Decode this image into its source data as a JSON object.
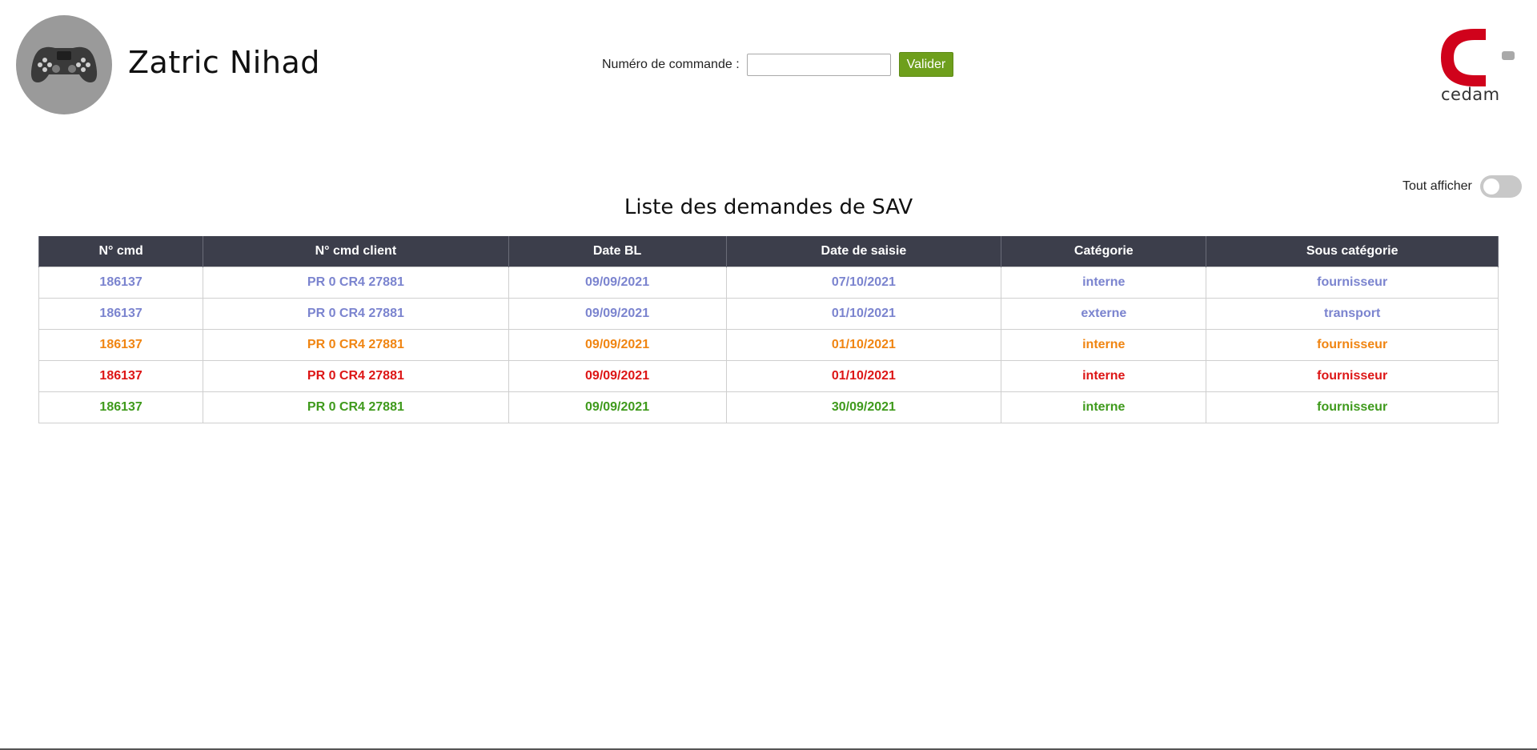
{
  "header": {
    "user_name": "Zatric Nihad",
    "avatar_icon": "gamepad-icon",
    "search": {
      "label": "Numéro de commande :",
      "value": "",
      "placeholder": "",
      "button_label": "Valider"
    },
    "logo": {
      "text": "cedam",
      "color": "#d0021b"
    }
  },
  "toggle": {
    "label": "Tout afficher",
    "state": "off"
  },
  "list": {
    "title": "Liste des demandes de SAV",
    "columns": [
      "N° cmd",
      "N° cmd client",
      "Date BL",
      "Date de saisie",
      "Catégorie",
      "Sous catégorie"
    ],
    "rows": [
      {
        "color": "#7b84cf",
        "cells": [
          "186137",
          "PR 0 CR4 27881",
          "09/09/2021",
          "07/10/2021",
          "interne",
          "fournisseur"
        ]
      },
      {
        "color": "#7b84cf",
        "cells": [
          "186137",
          "PR 0 CR4 27881",
          "09/09/2021",
          "01/10/2021",
          "externe",
          "transport"
        ]
      },
      {
        "color": "#f08512",
        "cells": [
          "186137",
          "PR 0 CR4 27881",
          "09/09/2021",
          "01/10/2021",
          "interne",
          "fournisseur"
        ]
      },
      {
        "color": "#dd1616",
        "cells": [
          "186137",
          "PR 0 CR4 27881",
          "09/09/2021",
          "01/10/2021",
          "interne",
          "fournisseur"
        ]
      },
      {
        "color": "#3f9a1c",
        "cells": [
          "186137",
          "PR 0 CR4 27881",
          "09/09/2021",
          "30/09/2021",
          "interne",
          "fournisseur"
        ]
      }
    ]
  }
}
